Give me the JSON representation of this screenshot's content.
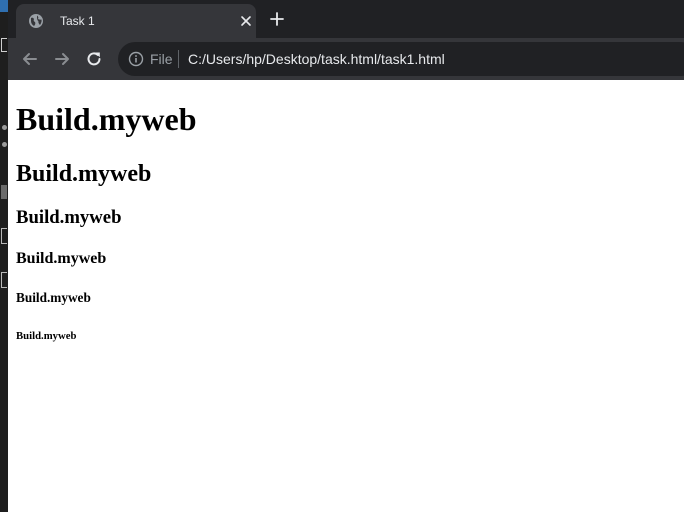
{
  "browser": {
    "tab": {
      "title": "Task 1"
    },
    "address_bar": {
      "scheme_label": "File",
      "url": "C:/Users/hp/Desktop/task.html/task1.html"
    }
  },
  "page": {
    "headings": [
      "Build.myweb",
      "Build.myweb",
      "Build.myweb",
      "Build.myweb",
      "Build.myweb",
      "Build.myweb"
    ]
  },
  "colors": {
    "tabstrip_bg": "#202124",
    "toolbar_bg": "#35363a",
    "omnibox_bg": "#202124",
    "page_bg": "#ffffff",
    "text": "#000000"
  }
}
